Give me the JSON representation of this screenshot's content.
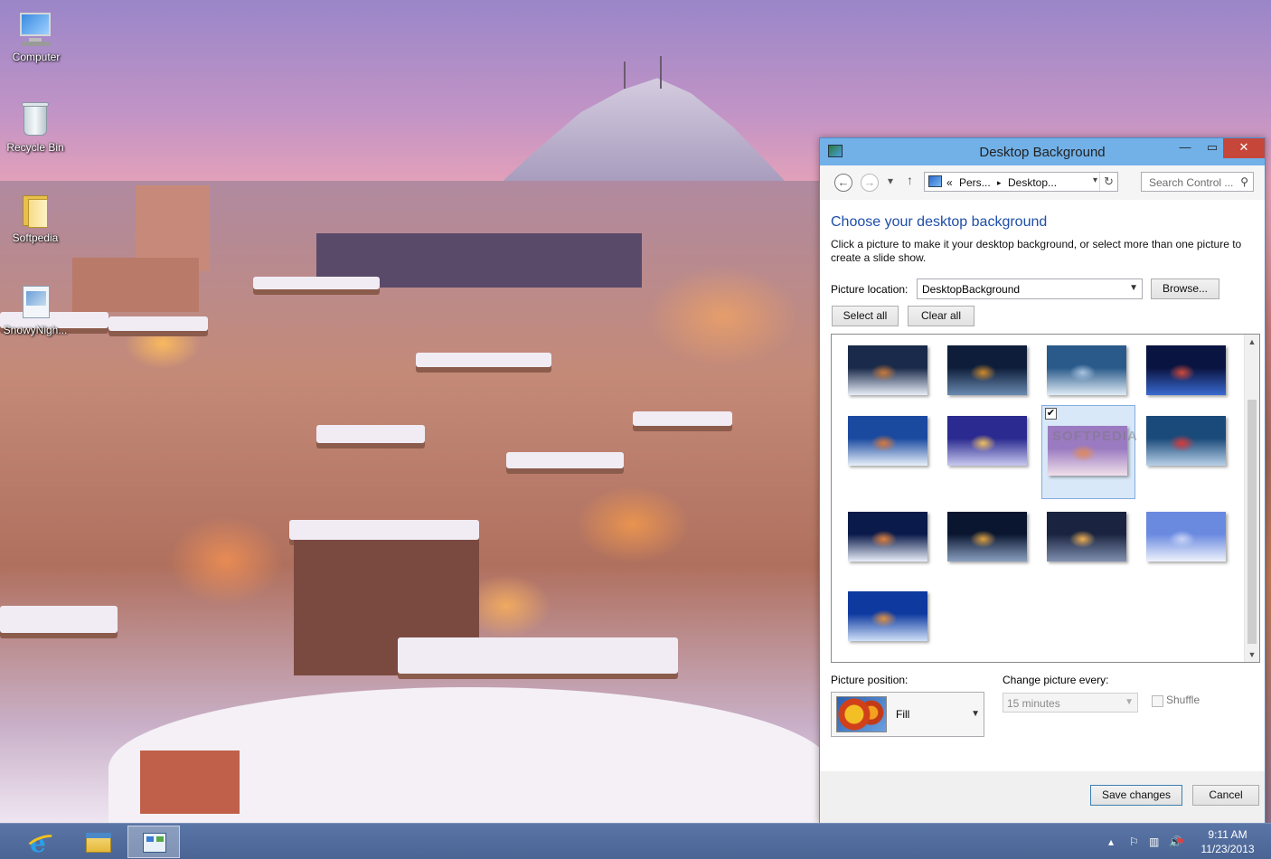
{
  "desktop": {
    "icons": [
      {
        "label": "Computer",
        "icon": "computer-icon"
      },
      {
        "label": "Recycle Bin",
        "icon": "recycle-bin-icon"
      },
      {
        "label": "Softpedia",
        "icon": "folder-icon"
      },
      {
        "label": "SnowyNigh...",
        "icon": "image-file-icon"
      }
    ]
  },
  "window": {
    "title": "Desktop Background",
    "controls": {
      "minimize": "—",
      "maximize": "▭",
      "close": "✕"
    },
    "nav": {
      "back": "←",
      "forward": "→",
      "recent": "▾",
      "up": "↑",
      "address": {
        "overflow": "«",
        "crumb1": "Pers...",
        "sep": "▸",
        "crumb2": "Desktop...",
        "dropdown": "▾",
        "refresh": "↻"
      },
      "search_placeholder": "Search Control ...",
      "search_icon": "⚲"
    },
    "heading": "Choose your desktop background",
    "description": "Click a picture to make it your desktop background, or select more than one picture to create a slide show.",
    "picture_location_label": "Picture location:",
    "picture_location_value": "DesktopBackground",
    "browse_label": "Browse...",
    "select_all_label": "Select all",
    "clear_all_label": "Clear all",
    "thumbnails": [
      {
        "name": "red-cabin-night",
        "colors": [
          "#1a2a4a",
          "#c87838",
          "#e8eef8"
        ],
        "selected": false
      },
      {
        "name": "lantern-snow-branches",
        "colors": [
          "#0e1e3a",
          "#d08a2a",
          "#6a8ab0"
        ],
        "selected": false
      },
      {
        "name": "snowy-valley-aerial",
        "colors": [
          "#2a5a8a",
          "#a8c4e0",
          "#e0ecf6"
        ],
        "selected": false
      },
      {
        "name": "christmas-tree-lights",
        "colors": [
          "#0a1440",
          "#d04a3a",
          "#3a6ad0"
        ],
        "selected": false
      },
      {
        "name": "blue-cabin-snow",
        "colors": [
          "#1a4aa0",
          "#d8783a",
          "#e8f0fa"
        ],
        "selected": false
      },
      {
        "name": "lantern-door-snow",
        "colors": [
          "#2a2a90",
          "#f0c060",
          "#c8c8f0"
        ],
        "selected": false
      },
      {
        "name": "snowy-town-dusk",
        "colors": [
          "#9a7ac0",
          "#e08a5a",
          "#f0e0ea"
        ],
        "selected": true
      },
      {
        "name": "festive-trees-blue",
        "colors": [
          "#1a4a7a",
          "#d83a3a",
          "#b8d0e8"
        ],
        "selected": false
      },
      {
        "name": "cabin-lights-night",
        "colors": [
          "#0a1a4a",
          "#e0803a",
          "#e8eef8"
        ],
        "selected": false
      },
      {
        "name": "lantern-night-snow",
        "colors": [
          "#0a1630",
          "#e0a040",
          "#8aa0c0"
        ],
        "selected": false
      },
      {
        "name": "city-street-lights",
        "colors": [
          "#1a2440",
          "#f0b050",
          "#8090b0"
        ],
        "selected": false
      },
      {
        "name": "frosted-forest-sky",
        "colors": [
          "#6a8ae0",
          "#c8d4f6",
          "#eef2fc"
        ],
        "selected": false
      },
      {
        "name": "cabin-blue-moonlight",
        "colors": [
          "#0e3aa0",
          "#e09040",
          "#d0e0f8"
        ],
        "selected": false
      }
    ],
    "checkmark": "✔",
    "watermark": "SOFTPEDIA",
    "scroll": {
      "up": "▲",
      "down": "▼"
    },
    "picture_position_label": "Picture position:",
    "picture_position_value": "Fill",
    "change_picture_label": "Change picture every:",
    "change_picture_value": "15 minutes",
    "shuffle_label": "Shuffle",
    "save_label": "Save changes",
    "cancel_label": "Cancel"
  },
  "taskbar": {
    "items": [
      {
        "name": "internet-explorer",
        "active": false
      },
      {
        "name": "file-explorer",
        "active": false
      },
      {
        "name": "control-panel",
        "active": true
      }
    ],
    "tray": {
      "flag": "⚐",
      "network": "▥",
      "volume": "🔊",
      "action_center": "⚑"
    },
    "time": "9:11 AM",
    "date": "11/23/2013"
  }
}
